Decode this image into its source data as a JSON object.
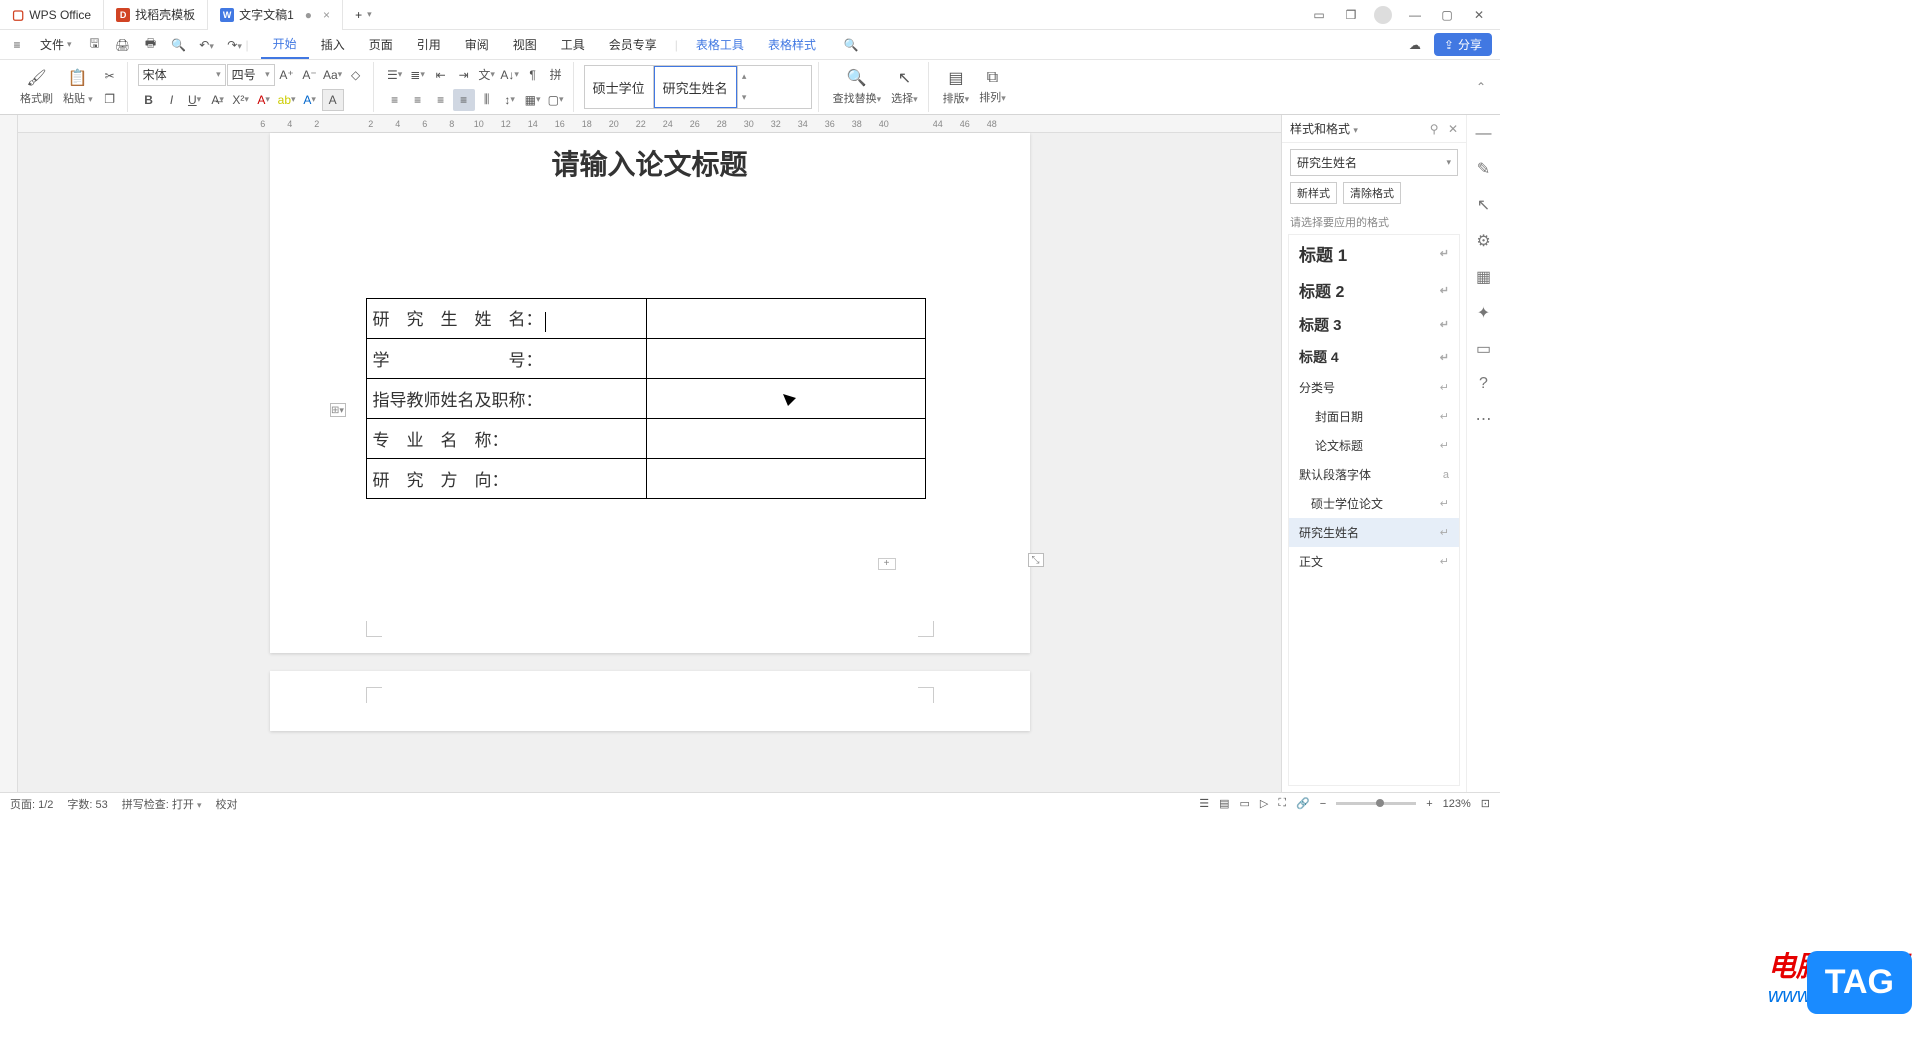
{
  "titlebar": {
    "app_name": "WPS Office",
    "tabs": [
      {
        "icon": "red",
        "icon_text": "D",
        "label": "找稻壳模板"
      },
      {
        "icon": "blue",
        "icon_text": "W",
        "label": "文字文稿1",
        "dirty": "●"
      }
    ],
    "add_tab": "+"
  },
  "menubar": {
    "file_label": "文件",
    "tabs": [
      "开始",
      "插入",
      "页面",
      "引用",
      "审阅",
      "视图",
      "工具",
      "会员专享"
    ],
    "table_tabs": [
      "表格工具",
      "表格样式"
    ],
    "share_label": "分享"
  },
  "ribbon": {
    "format_painter": "格式刷",
    "paste": "粘贴",
    "font_name": "宋体",
    "font_size": "四号",
    "style_preview_1": "硕士学位",
    "style_preview_2": "研究生姓名",
    "find_replace": "查找替换",
    "select": "选择",
    "layout": "排版",
    "arrange": "排列"
  },
  "ruler_top": [
    "6",
    "",
    "4",
    "",
    "2",
    "",
    "",
    "",
    "2",
    "",
    "4",
    "",
    "6",
    "",
    "8",
    "",
    "10",
    "",
    "12",
    "",
    "14",
    "",
    "16",
    "",
    "18",
    "",
    "20",
    "",
    "22",
    "",
    "24",
    "",
    "26",
    "",
    "28",
    "",
    "30",
    "",
    "32",
    "",
    "34",
    "",
    "36",
    "",
    "38",
    "",
    "40",
    "",
    "",
    "",
    "44",
    "",
    "46",
    "",
    "48"
  ],
  "document": {
    "title": "请输入论文标题",
    "rows": [
      {
        "label": "研　究　生　姓　名：",
        "value": ""
      },
      {
        "label": "学　　　　　　　号：",
        "value": ""
      },
      {
        "label": "指导教师姓名及职称：",
        "value": ""
      },
      {
        "label": "专　业　名　称：",
        "value": ""
      },
      {
        "label": "研　究　方　向：",
        "value": ""
      }
    ]
  },
  "style_panel": {
    "title": "样式和格式",
    "current_style": "研究生姓名",
    "btn_new": "新样式",
    "btn_clear": "清除格式",
    "hint": "请选择要应用的格式",
    "items": [
      {
        "label": "标题 1",
        "cls": "h1"
      },
      {
        "label": "标题 2",
        "cls": "h2"
      },
      {
        "label": "标题 3",
        "cls": "h3"
      },
      {
        "label": "标题 4",
        "cls": "h4"
      },
      {
        "label": "分类号",
        "cls": ""
      },
      {
        "label": "封面日期",
        "cls": "indent"
      },
      {
        "label": "论文标题",
        "cls": "indent"
      },
      {
        "label": "默认段落字体",
        "cls": ""
      },
      {
        "label": "硕士学位论文",
        "cls": "indent2"
      },
      {
        "label": "研究生姓名",
        "cls": "selected"
      },
      {
        "label": "正文",
        "cls": ""
      }
    ]
  },
  "statusbar": {
    "page": "页面: 1/2",
    "words": "字数: 53",
    "spell": "拼写检查: 打开",
    "proof": "校对",
    "zoom": "123%"
  },
  "watermark": {
    "cn": "电脑技术网",
    "url": "www.tagxp.com",
    "tag": "TAG"
  }
}
